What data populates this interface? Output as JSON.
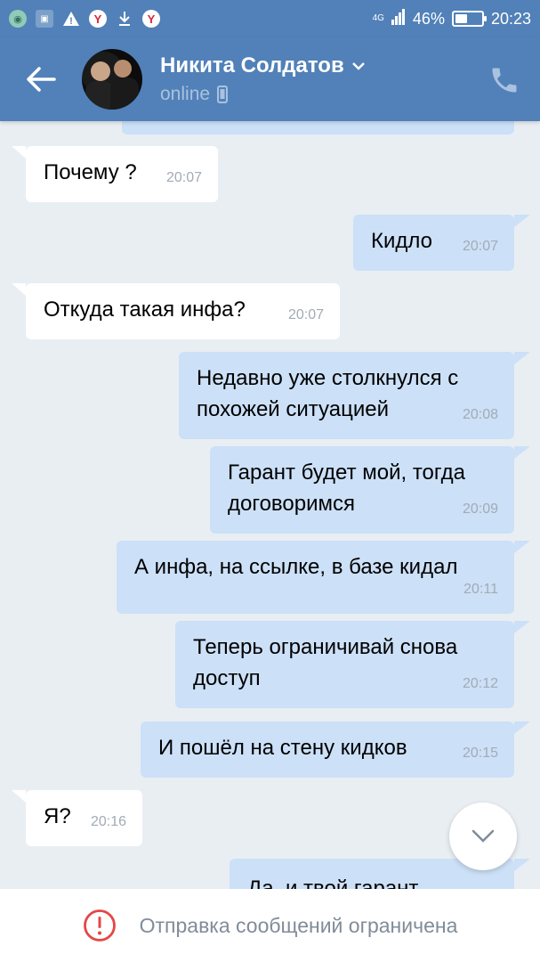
{
  "status_bar": {
    "network": "4G",
    "battery_percent": "46%",
    "battery_level": 0.46,
    "time": "20:23",
    "notification_icons": [
      "green-circle-icon",
      "image-icon",
      "warning-icon",
      "yandex-icon",
      "download-icon",
      "yandex-icon"
    ]
  },
  "header": {
    "contact_name": "Никита Солдатов",
    "status": "online",
    "accent_color": "#5181b8"
  },
  "messages": [
    {
      "direction": "in",
      "text": "Почему ?",
      "time": "20:07"
    },
    {
      "direction": "out",
      "text": "Кидло",
      "time": "20:07"
    },
    {
      "direction": "in",
      "text": "Откуда такая инфа?",
      "time": "20:07"
    },
    {
      "direction": "out",
      "text": "Недавно уже столкнулся с похожей ситуацией",
      "time": "20:08"
    },
    {
      "direction": "out",
      "text": "Гарант будет мой, тогда договоримся",
      "time": "20:09"
    },
    {
      "direction": "out",
      "text": "А инфа, на ссылке, в базе кидал",
      "time": "20:11"
    },
    {
      "direction": "out",
      "text": "Теперь ограничивай снова доступ",
      "time": "20:12"
    },
    {
      "direction": "out",
      "text": "И пошёл на стену кидков",
      "time": "20:15"
    },
    {
      "direction": "in",
      "text": "Я?",
      "time": "20:16"
    },
    {
      "direction": "out",
      "text": "Да, и твой гарант",
      "time": ""
    }
  ],
  "footer": {
    "notice": "Отправка сообщений ограничена",
    "notice_color": "#e64646"
  }
}
